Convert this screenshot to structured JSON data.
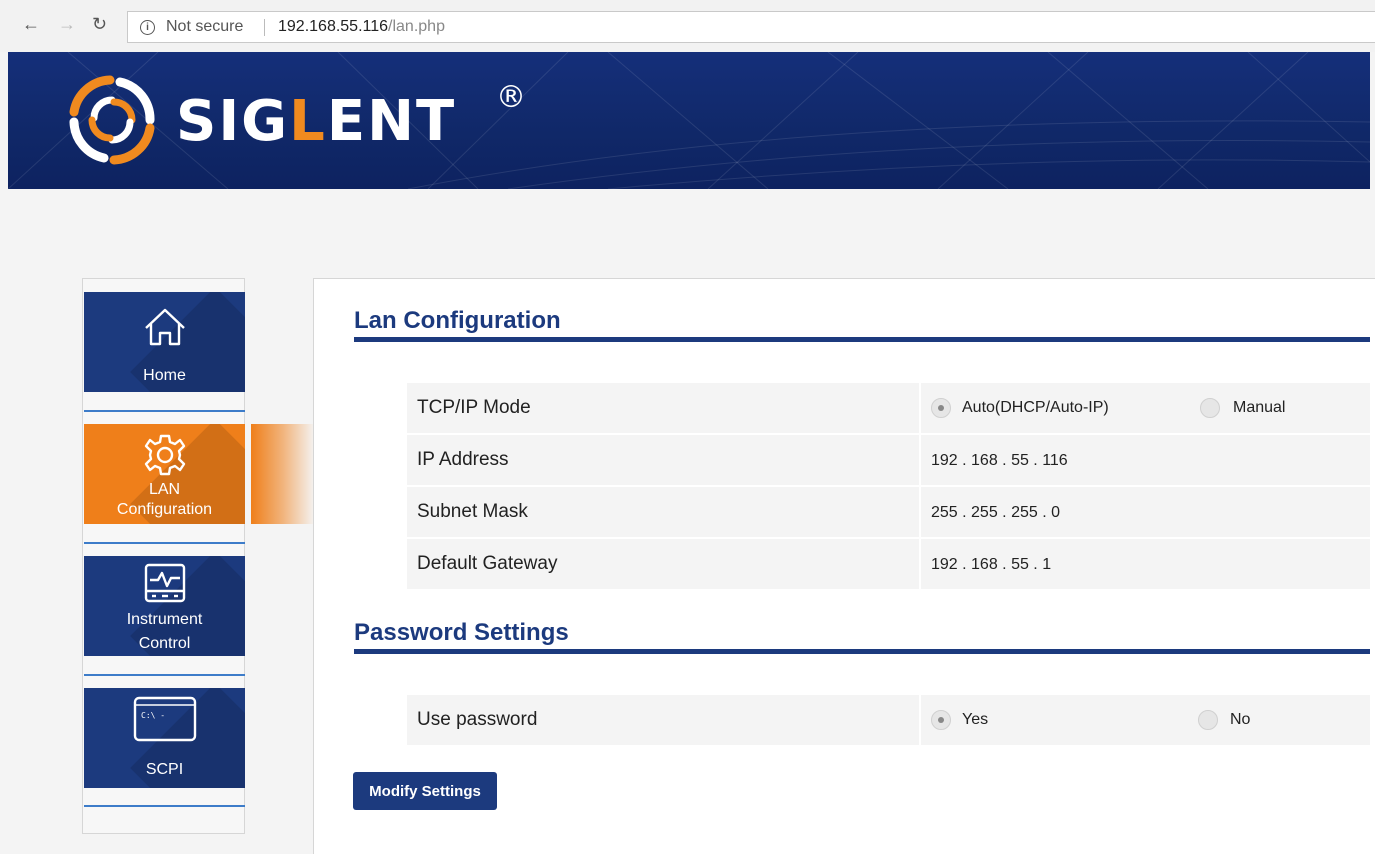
{
  "browser": {
    "security_text": "Not secure",
    "url_host": "192.168.55.116",
    "url_path": "/lan.php"
  },
  "brand": {
    "logo_text_pre": "SIG",
    "logo_text_accent": "L",
    "logo_text_post": "ENT",
    "registered_mark": "®",
    "accent_color": "#f08a1f",
    "primary_color": "#1c3a7e"
  },
  "sidebar": {
    "items": [
      {
        "label": "Home",
        "icon": "home-icon",
        "active": false
      },
      {
        "label": "LAN",
        "label2": "Configuration",
        "icon": "gear-icon",
        "active": true
      },
      {
        "label": "Instrument",
        "label2": "Control",
        "icon": "monitor-icon",
        "active": false
      },
      {
        "label": "SCPI",
        "icon": "terminal-icon",
        "icon_text": "C:\\ -",
        "active": false
      }
    ]
  },
  "lan": {
    "title": "Lan Configuration",
    "tcpip_mode_label": "TCP/IP Mode",
    "mode_options": [
      {
        "label": "Auto(DHCP/Auto-IP)",
        "checked": true
      },
      {
        "label": "Manual",
        "checked": false
      }
    ],
    "ip_label": "IP Address",
    "ip_value": "192 . 168 . 55 . 116",
    "subnet_label": "Subnet Mask",
    "subnet_value": "255 . 255 . 255 . 0",
    "gateway_label": "Default Gateway",
    "gateway_value": "192 . 168 . 55 . 1"
  },
  "password": {
    "title": "Password Settings",
    "use_label": "Use password",
    "options": [
      {
        "label": "Yes",
        "checked": true
      },
      {
        "label": "No",
        "checked": false
      }
    ]
  },
  "actions": {
    "modify_label": "Modify Settings"
  }
}
